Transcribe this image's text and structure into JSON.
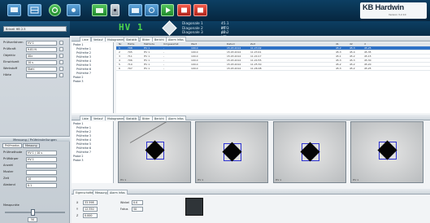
{
  "app": {
    "brand": "KB Hardwin",
    "brand_sub": "Version 3.2.10"
  },
  "toolbar": {
    "hv_value": "HV 1",
    "diagonals": [
      {
        "label": "Diagonale 1",
        "value": "45.1 μm"
      },
      {
        "label": "Diagonale 2",
        "value": "45.3 μm"
      },
      {
        "label": "Diagonale 3",
        "value": "45.2 μm"
      }
    ],
    "icons": [
      "monitor-icon",
      "grid-icon",
      "power-icon",
      "settings-icon",
      "camera-icon",
      "dot-icon",
      "camera-icon",
      "target-icon",
      "stop-icon",
      "stop-icon"
    ]
  },
  "left_panel": {
    "header_select": "Brinell HB 2.5",
    "fields": [
      {
        "label": "Prüfverfahren",
        "value": "HV 1"
      },
      {
        "label": "Prüfkraft",
        "value": "9.81 N"
      },
      {
        "label": "Objektiv",
        "value": "40x"
      },
      {
        "label": "Einwirkzeit",
        "value": "10 s"
      },
      {
        "label": "Werkstoff",
        "value": "Stahl"
      },
      {
        "label": "Härte",
        "value": ""
      }
    ],
    "measurement_header": "Messung / Prüfeinstellungen",
    "tabs": [
      "Prüfmodus",
      "Messung"
    ],
    "bottom_fields": [
      {
        "label": "Prüfmethode",
        "value": "HV 1 / 10 s"
      },
      {
        "label": "Prüfkörper",
        "value": "HV 1"
      },
      {
        "label": "Anzahl",
        "value": ""
      },
      {
        "label": "Muster",
        "value": ""
      },
      {
        "label": "Zeit",
        "value": "10"
      },
      {
        "label": "Abstand",
        "value": "0.1"
      }
    ],
    "slider_label": "Messpunkte",
    "slider_value": "50"
  },
  "top_tabs": [
    "Liste",
    "Verlauf",
    "Histogramm",
    "Statistik",
    "Bilder",
    "Bericht",
    "Alarm Infos"
  ],
  "tree": {
    "root": "Probe 1",
    "items": [
      "Prüfreihe 1",
      "Prüfreihe 2",
      "Prüfreihe 3",
      "Prüfreihe 4",
      "Prüfreihe 5",
      "Prüfreihe 6",
      "Prüfreihe 7",
      "Probe 2",
      "Probe 3"
    ]
  },
  "table": {
    "columns": [
      "Nr.",
      "Härte",
      "Methode",
      "Umgewertet",
      "Wert",
      "Datum",
      "Zeit",
      "d1",
      "d2",
      "d"
    ],
    "rows": [
      [
        "1",
        "708",
        "HV 1",
        "-",
        "100.0",
        "15.03.2014",
        "11:23:02",
        "45.2",
        "45.3",
        "45.25"
      ],
      [
        "2",
        "705",
        "HV 1",
        "-",
        "100.0",
        "15.03.2014",
        "11:23:41",
        "45.3",
        "45.4",
        "45.35"
      ],
      [
        "3",
        "711",
        "HV 1",
        "-",
        "100.0",
        "15.03.2014",
        "11:24:17",
        "45.1",
        "45.2",
        "45.15"
      ],
      [
        "4",
        "706",
        "HV 1",
        "-",
        "100.0",
        "15.03.2014",
        "11:24:55",
        "45.3",
        "45.3",
        "45.30"
      ],
      [
        "5",
        "710",
        "HV 1",
        "-",
        "100.0",
        "15.03.2014",
        "11:25:30",
        "45.2",
        "45.2",
        "45.20"
      ],
      [
        "6",
        "707",
        "HV 1",
        "-",
        "100.0",
        "15.03.2014",
        "11:26:08",
        "45.3",
        "45.2",
        "45.25"
      ]
    ],
    "selected_row": 0
  },
  "middle_tabs": [
    "Liste",
    "Verlauf",
    "Histogramm",
    "Statistik",
    "Bilder",
    "Bericht",
    "Alarm Infos"
  ],
  "image_labels": [
    "HV 1",
    "HV 1",
    "HV 1",
    "HV 1"
  ],
  "bottom": {
    "tabs": [
      "Eigenschaften",
      "Messung",
      "Alarm Infos"
    ],
    "fields": [
      {
        "label": "X",
        "value": "33.598"
      },
      {
        "label": "Y",
        "value": "12.350"
      },
      {
        "label": "Z",
        "value": "0.000"
      },
      {
        "label": "Winkel",
        "value": "0.0"
      },
      {
        "label": "Fokus",
        "value": "50"
      }
    ]
  }
}
